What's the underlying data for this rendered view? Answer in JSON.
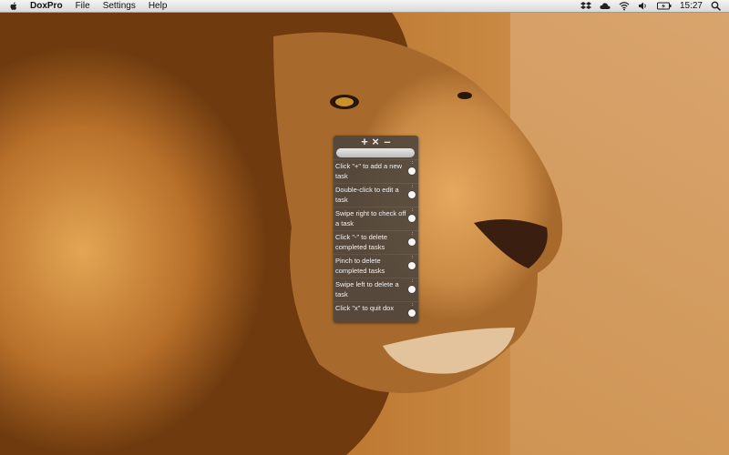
{
  "menubar": {
    "app_name": "DoxPro",
    "menus": [
      "File",
      "Settings",
      "Help"
    ],
    "status_icons": [
      "dropbox-icon",
      "cloud-icon",
      "wifi-icon",
      "volume-icon",
      "battery-icon"
    ],
    "clock": "15:27",
    "search_icon": "spotlight-icon"
  },
  "dox": {
    "toolbar": {
      "add": "+",
      "close": "×",
      "remove": "–"
    },
    "input_value": "",
    "tasks": [
      "Click \"+\" to add a new task",
      "Double-click to edit a task",
      "Swipe right to check off a task",
      "Click \"-\" to delete completed tasks",
      "Pinch to delete completed tasks",
      "Swipe left to delete a task",
      "Click \"x\" to quit dox"
    ]
  },
  "colors": {
    "widget_bg": "#48423c",
    "menubar_bg": "#e6e6e6"
  }
}
